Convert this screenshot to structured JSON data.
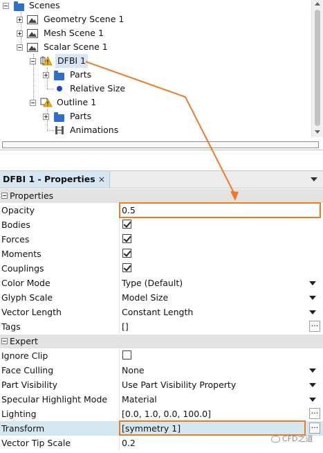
{
  "tree": {
    "items": [
      {
        "label": "Scenes",
        "icon": "folder-icon",
        "expander": "minus"
      },
      {
        "label": "Geometry Scene 1",
        "icon": "scene-icon",
        "expander": "plus"
      },
      {
        "label": "Mesh Scene 1",
        "icon": "scene-icon",
        "expander": "plus"
      },
      {
        "label": "Scalar Scene 1",
        "icon": "scene-icon",
        "expander": "minus"
      },
      {
        "label": "DFBI 1",
        "icon": "displayer-warning-icon",
        "expander": "minus"
      },
      {
        "label": "Parts",
        "icon": "folder-icon",
        "expander": "plus"
      },
      {
        "label": "Relative Size",
        "icon": "dot-icon",
        "expander": "none"
      },
      {
        "label": "Outline 1",
        "icon": "displayer-warning-icon",
        "expander": "minus"
      },
      {
        "label": "Parts",
        "icon": "folder-icon",
        "expander": "plus"
      },
      {
        "label": "Animations",
        "icon": "film-icon",
        "expander": "none"
      }
    ]
  },
  "properties": {
    "tab_title": "DFBI 1 - Properties",
    "tab_close": "×",
    "sections": [
      {
        "name": "Properties",
        "rows": [
          {
            "name": "Opacity",
            "value": "0.5",
            "kind": "text"
          },
          {
            "name": "Bodies",
            "value": "",
            "kind": "checkbox",
            "checked": true
          },
          {
            "name": "Forces",
            "value": "",
            "kind": "checkbox",
            "checked": true
          },
          {
            "name": "Moments",
            "value": "",
            "kind": "checkbox",
            "checked": true
          },
          {
            "name": "Couplings",
            "value": "",
            "kind": "checkbox",
            "checked": true
          },
          {
            "name": "Color Mode",
            "value": "Type (Default)",
            "kind": "dropdown"
          },
          {
            "name": "Glyph Scale",
            "value": "Model Size",
            "kind": "dropdown"
          },
          {
            "name": "Vector Length",
            "value": "Constant Length",
            "kind": "dropdown"
          },
          {
            "name": "Tags",
            "value": "[]",
            "kind": "ellipsis"
          }
        ]
      },
      {
        "name": "Expert",
        "rows": [
          {
            "name": "Ignore Clip",
            "value": "",
            "kind": "checkbox",
            "checked": false
          },
          {
            "name": "Face Culling",
            "value": "None",
            "kind": "dropdown"
          },
          {
            "name": "Part Visibility",
            "value": "Use Part Visibility Property",
            "kind": "dropdown"
          },
          {
            "name": "Specular Highlight Mode",
            "value": "Material",
            "kind": "dropdown"
          },
          {
            "name": "Lighting",
            "value": "[0.0, 1.0, 0.0, 100.0]",
            "kind": "ellipsis"
          },
          {
            "name": "Transform",
            "value": "[symmetry 1]",
            "kind": "ellipsis"
          },
          {
            "name": "Vector Tip Scale",
            "value": "0.2",
            "kind": "text"
          }
        ]
      }
    ]
  },
  "ellipsis_label": "...",
  "watermark": "CFD之道",
  "colors": {
    "highlight": "#f07a24",
    "selected_row": "#d5e8f2",
    "tab": "#d6e6f2",
    "folder": "#2f6fc9"
  }
}
